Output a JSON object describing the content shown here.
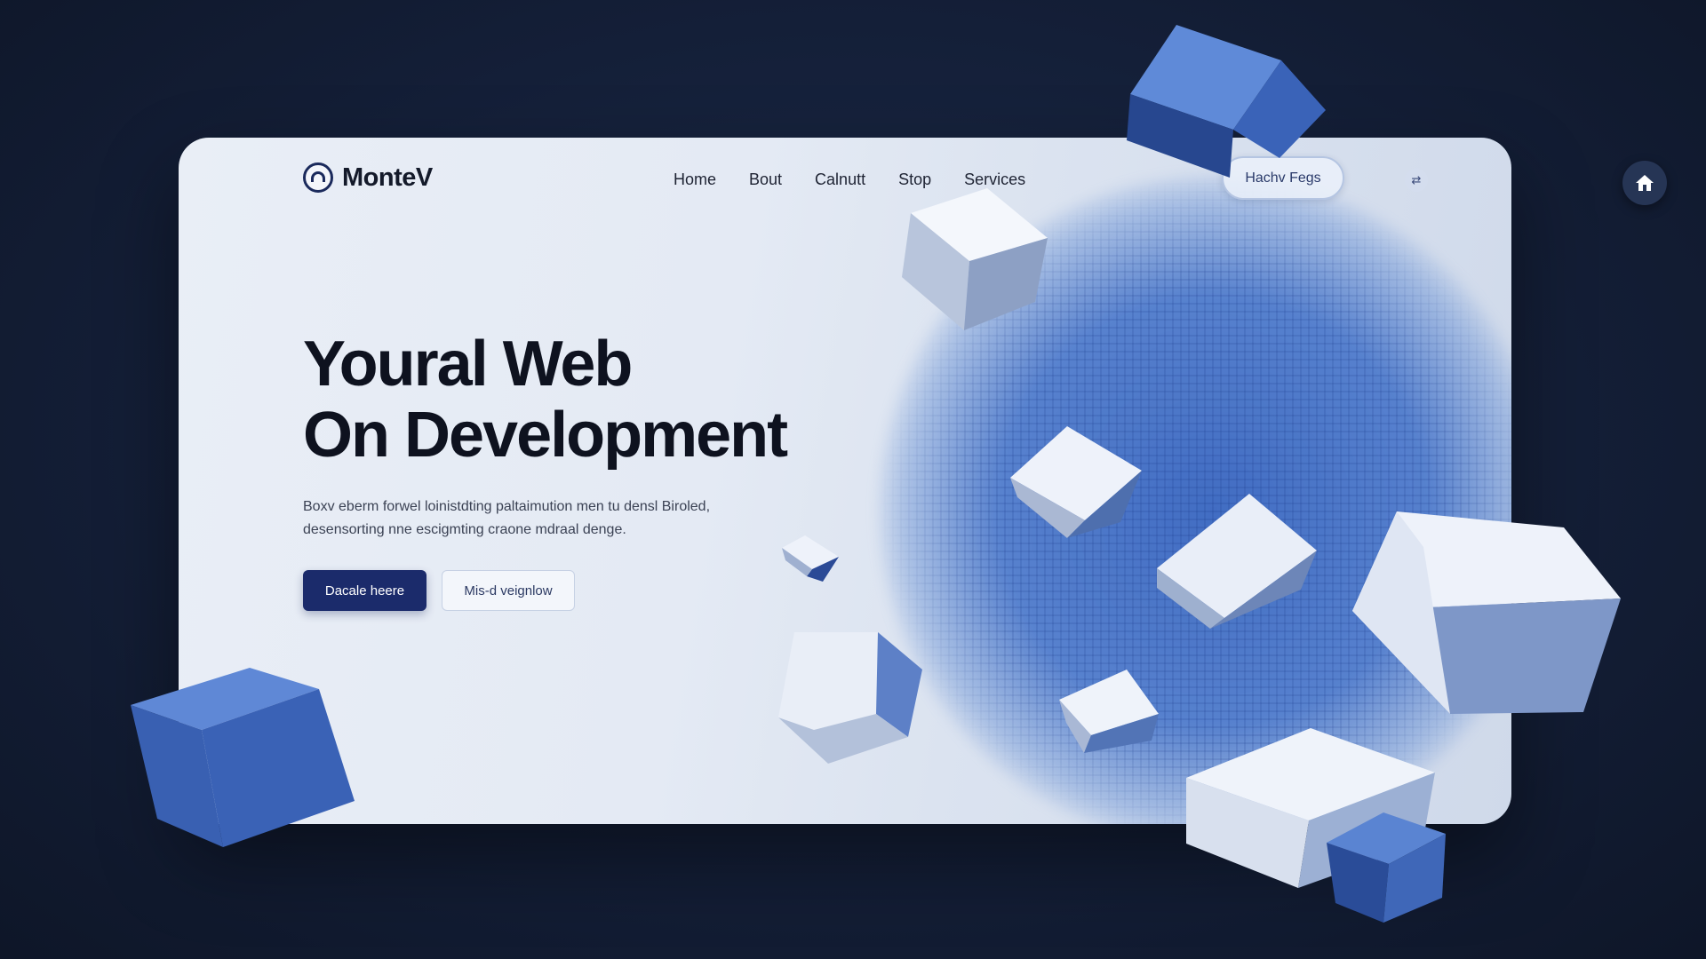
{
  "brand": {
    "name": "MonteV"
  },
  "nav": {
    "items": [
      "Home",
      "Bout",
      "Calnutt",
      "Stop",
      "Services"
    ],
    "cta_label": "Hachv Fegs"
  },
  "hero": {
    "title_line1": "Youral Web",
    "title_line2": "On Development",
    "description": "Boxv eberm forwel loinistdting paltaimution men tu densl Biroled, desensorting nne escigmting craone mdraal denge.",
    "primary_button": "Dacale heere",
    "secondary_button": "Mis-d veignlow"
  },
  "icons": {
    "logo": "logo-mark-icon",
    "nav_toggle": "swap-arrows-icon",
    "home": "home-icon"
  },
  "colors": {
    "background": "#141f38",
    "card": "#e6ecf5",
    "accent_blue": "#3f6fc4",
    "primary_button": "#1b2b6b",
    "title_text": "#0e121f"
  }
}
